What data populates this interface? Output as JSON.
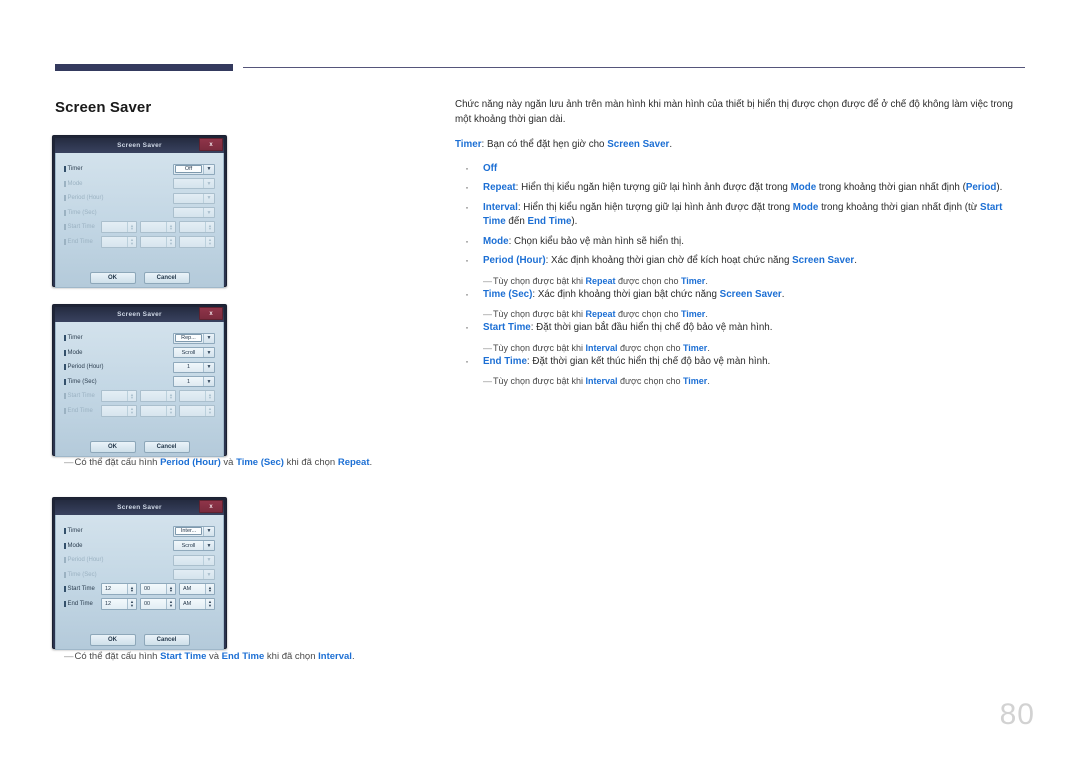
{
  "header": {
    "rule_color": "#343a5e"
  },
  "section": {
    "title": "Screen Saver"
  },
  "page_number": "80",
  "dialog_common": {
    "title": "Screen Saver",
    "close_label": "x",
    "ok_label": "OK",
    "cancel_label": "Cancel",
    "labels": {
      "timer": "Timer",
      "mode": "Mode",
      "period": "Period (Hour)",
      "time_sec": "Time (Sec)",
      "start_time": "Start Time",
      "end_time": "End Time"
    },
    "caret": "▼",
    "spin_up": "▲",
    "spin_down": "▼"
  },
  "dialogs": [
    {
      "name": "screen-saver-off",
      "timer_value": "Off",
      "mode_value": "",
      "period_value": "",
      "time_sec_value": "",
      "start_time": [
        "",
        "",
        ""
      ],
      "end_time": [
        "",
        "",
        ""
      ],
      "enabled": {
        "timer": true,
        "mode": false,
        "period": false,
        "time_sec": false,
        "start_time": false,
        "end_time": false
      }
    },
    {
      "name": "screen-saver-repeat",
      "timer_value": "Rep...",
      "mode_value": "Scroll",
      "period_value": "1",
      "time_sec_value": "1",
      "start_time": [
        "",
        "",
        ""
      ],
      "end_time": [
        "",
        "",
        ""
      ],
      "enabled": {
        "timer": true,
        "mode": true,
        "period": true,
        "time_sec": true,
        "start_time": false,
        "end_time": false
      }
    },
    {
      "name": "screen-saver-interval",
      "timer_value": "Inter...",
      "mode_value": "Scroll",
      "period_value": "",
      "time_sec_value": "",
      "start_time": [
        "12",
        "00",
        "AM"
      ],
      "end_time": [
        "12",
        "00",
        "AM"
      ],
      "enabled": {
        "timer": true,
        "mode": true,
        "period": false,
        "time_sec": false,
        "start_time": true,
        "end_time": true
      }
    }
  ],
  "captions": {
    "repeat_note": {
      "dash": "—",
      "t1": "Có thể đặt cấu hình ",
      "k1": "Period (Hour)",
      "t2": " và ",
      "k2": "Time (Sec)",
      "t3": " khi đã chọn ",
      "k3": "Repeat",
      "t4": "."
    },
    "interval_note": {
      "dash": "—",
      "t1": "Có thể đặt cấu hình ",
      "k1": "Start Time",
      "t2": " và ",
      "k2": "End Time",
      "t3": " khi đã chọn ",
      "k3": "Interval",
      "t4": "."
    }
  },
  "body": {
    "lead": "Chức năng này ngăn lưu ảnh trên màn hình khi màn hình của thiết bị hiển thị được chọn được để ở chế độ không làm việc trong một khoảng thời gian dài.",
    "timer_line": {
      "k1": "Timer",
      "t1": ": Bạn có thể đặt hẹn giờ cho ",
      "k2": "Screen Saver",
      "t2": "."
    },
    "items": [
      {
        "k1": "Off",
        "t1": ""
      },
      {
        "k1": "Repeat",
        "t1": ": Hiển thị kiểu ngăn hiện tượng giữ lại hình ảnh được đặt trong ",
        "k2": "Mode",
        "t2": " trong khoảng thời gian nhất định (",
        "k3": "Period",
        "t3": ")."
      },
      {
        "k1": "Interval",
        "t1": ": Hiển thị kiểu ngăn hiện tượng giữ lại hình ảnh được đặt trong ",
        "k2": "Mode",
        "t2": " trong khoảng thời gian nhất định (từ ",
        "k3": "Start Time",
        "t3": " đến ",
        "k4": "End Time",
        "t4": ")."
      },
      {
        "k1": "Mode",
        "t1": ": Chọn kiểu bảo vệ màn hình sẽ hiển thị."
      },
      {
        "k1": "Period (Hour)",
        "t1": ": Xác định khoảng thời gian chờ để kích hoạt chức năng ",
        "k2": "Screen Saver",
        "t2": "."
      },
      {
        "k1": "Time (Sec)",
        "t1": ": Xác định khoảng thời gian bật chức năng ",
        "k2": "Screen Saver",
        "t2": "."
      },
      {
        "k1": "Start Time",
        "t1": ": Đặt thời gian bắt đầu hiển thị chế độ bảo vệ màn hình."
      },
      {
        "k1": "End Time",
        "t1": ": Đặt thời gian kết thúc hiển thị chế độ bảo vệ màn hình."
      }
    ],
    "notes": {
      "repeat": {
        "dash": "—",
        "t1": "Tùy chọn được bật khi ",
        "k1": "Repeat",
        "t2": " được chọn cho ",
        "k2": "Timer",
        "t3": "."
      },
      "interval": {
        "dash": "—",
        "t1": "Tùy chọn được bật khi ",
        "k1": "Interval",
        "t2": " được chọn cho ",
        "k2": "Timer",
        "t3": "."
      }
    }
  }
}
